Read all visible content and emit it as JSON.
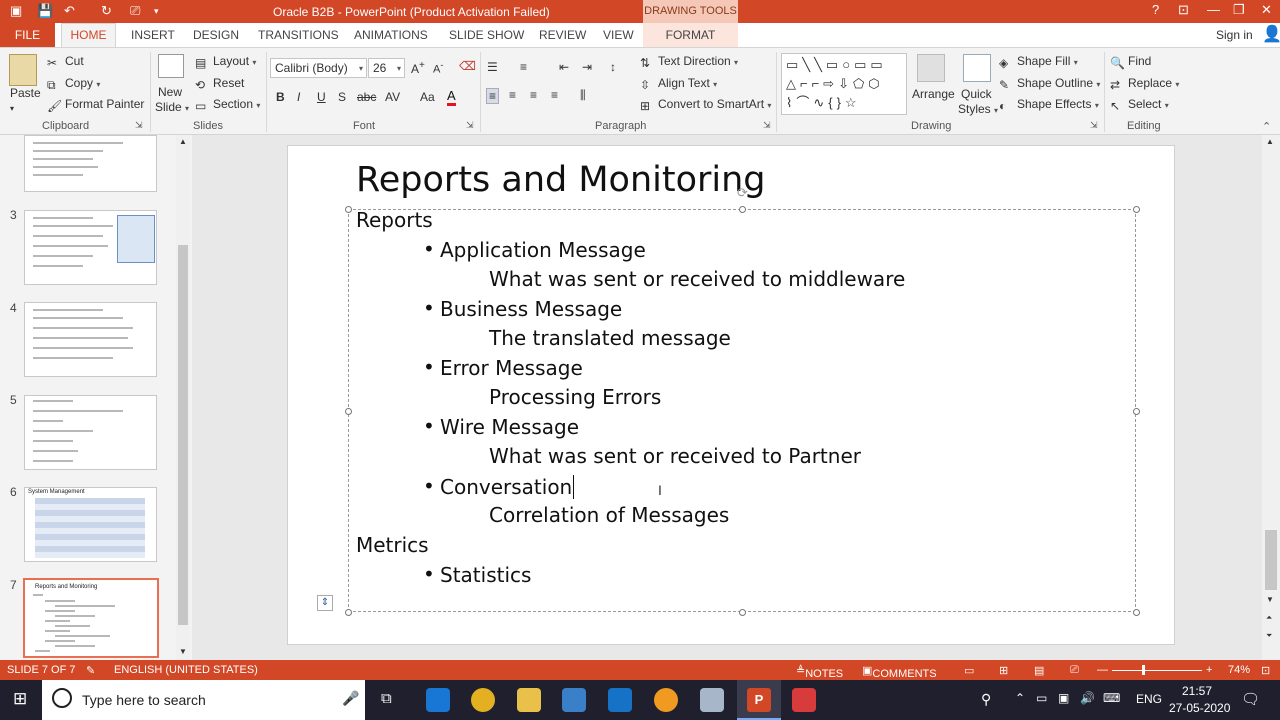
{
  "window": {
    "title": "Oracle B2B  -  PowerPoint (Product Activation Failed)",
    "context_tab": "DRAWING TOOLS"
  },
  "tabs": [
    "FILE",
    "HOME",
    "INSERT",
    "DESIGN",
    "TRANSITIONS",
    "ANIMATIONS",
    "SLIDE SHOW",
    "REVIEW",
    "VIEW",
    "FORMAT"
  ],
  "signin": "Sign in",
  "ribbon": {
    "clipboard": {
      "paste": "Paste",
      "cut": "Cut",
      "copy": "Copy",
      "format_painter": "Format Painter",
      "label": "Clipboard"
    },
    "slides": {
      "new_slide_1": "New",
      "new_slide_2": "Slide",
      "layout": "Layout",
      "reset": "Reset",
      "section": "Section",
      "label": "Slides"
    },
    "font": {
      "family": "Calibri (Body)",
      "size": "26",
      "label": "Font"
    },
    "paragraph": {
      "text_direction": "Text Direction",
      "align_text": "Align Text",
      "convert_smartart": "Convert to SmartArt",
      "label": "Paragraph"
    },
    "drawing": {
      "arrange": "Arrange",
      "quick_styles_1": "Quick",
      "quick_styles_2": "Styles",
      "shape_fill": "Shape Fill",
      "shape_outline": "Shape Outline",
      "shape_effects": "Shape Effects",
      "label": "Drawing"
    },
    "editing": {
      "find": "Find",
      "replace": "Replace",
      "select": "Select",
      "label": "Editing"
    }
  },
  "thumbnails": [
    {
      "num": "3"
    },
    {
      "num": "4"
    },
    {
      "num": "5"
    },
    {
      "num": "6"
    },
    {
      "num": "7"
    }
  ],
  "thumb6_title": "System Management",
  "thumb7_title": "Reports and Monitoring",
  "slide": {
    "title": "Reports and Monitoring",
    "lines": [
      {
        "text": "Reports",
        "level": 0
      },
      {
        "text": "Application Message",
        "level": 1
      },
      {
        "text": "What was sent or received to middleware",
        "level": 2
      },
      {
        "text": "Business Message",
        "level": 1
      },
      {
        "text": "The translated message",
        "level": 2
      },
      {
        "text": "Error Message",
        "level": 1
      },
      {
        "text": "Processing Errors",
        "level": 2
      },
      {
        "text": "Wire Message",
        "level": 1
      },
      {
        "text": "What was sent or received to Partner",
        "level": 2
      },
      {
        "text": "Conversation",
        "level": 1
      },
      {
        "text": "Correlation of Messages",
        "level": 2
      },
      {
        "text": "Metrics",
        "level": 0
      },
      {
        "text": "Statistics",
        "level": 1
      }
    ]
  },
  "status": {
    "slide": "SLIDE 7 OF 7",
    "language": "ENGLISH (UNITED STATES)",
    "notes": "NOTES",
    "comments": "COMMENTS",
    "zoom": "74%"
  },
  "taskbar": {
    "search_placeholder": "Type here to search",
    "lang": "ENG",
    "time": "21:57",
    "date": "27-05-2020"
  },
  "colors": {
    "accent": "#d24726",
    "format_tab": "#fbe5dc"
  }
}
